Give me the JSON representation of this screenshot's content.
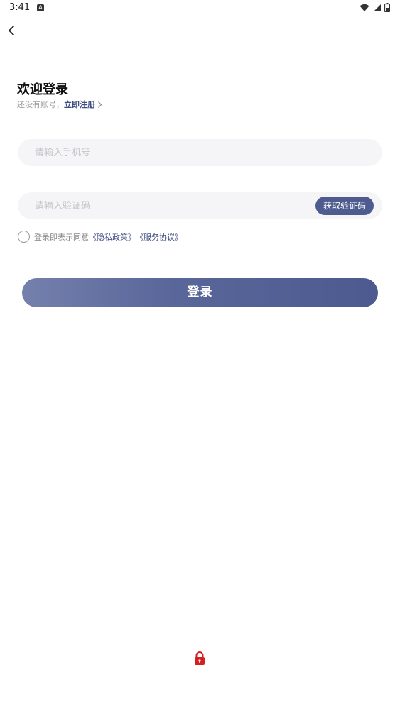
{
  "status_bar": {
    "time": "3:41",
    "notification_icon": "A",
    "icons": [
      "wifi-icon",
      "cell-signal-icon",
      "battery-icon"
    ]
  },
  "header": {
    "back_icon": "chevron-left-icon"
  },
  "welcome": {
    "title": "欢迎登录",
    "subtitle_prefix": "还没有账号，",
    "register_link": "立即注册"
  },
  "form": {
    "phone_placeholder": "请输入手机号",
    "phone_value": "",
    "code_placeholder": "请输入验证码",
    "code_value": "",
    "get_code_label": "获取验证码"
  },
  "agreement": {
    "checked": false,
    "prefix": "登录即表示同意",
    "privacy_link": "《隐私政策》",
    "terms_link": "《服务协议》"
  },
  "actions": {
    "login_label": "登录"
  },
  "colors": {
    "accent": "#4e5b8f",
    "link": "#3d4c82",
    "field_bg": "#f5f5f7",
    "lock_red": "#d42020"
  }
}
